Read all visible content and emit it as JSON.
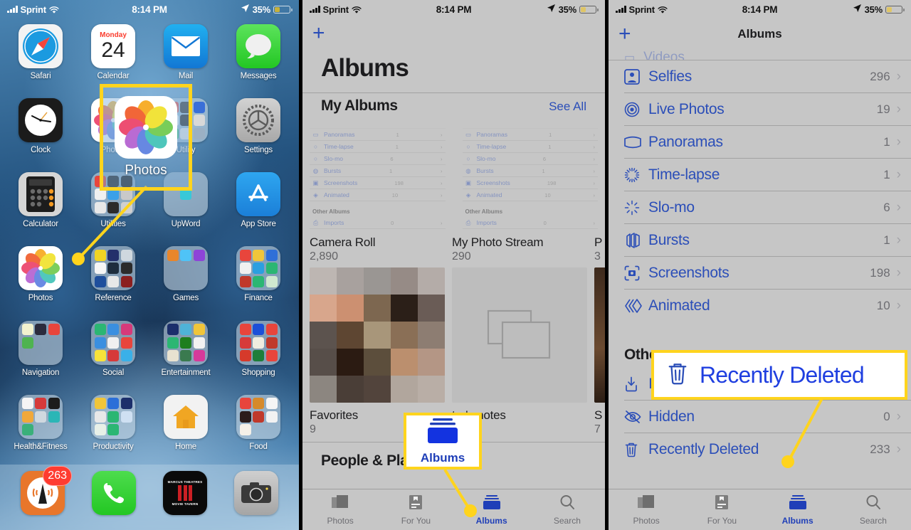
{
  "status_bar": {
    "carrier": "Sprint",
    "time": "8:14 PM",
    "battery": "35%"
  },
  "left_panel": {
    "apps": [
      {
        "label": "Safari",
        "icon": "safari-icon"
      },
      {
        "label": "Calendar",
        "icon": "calendar-icon",
        "weekday": "Monday",
        "day": "24"
      },
      {
        "label": "Mail",
        "icon": "mail-icon"
      },
      {
        "label": "Messages",
        "icon": "messages-icon"
      },
      {
        "label": "Clock",
        "icon": "clock-icon"
      },
      {
        "label": "Photos",
        "icon": "photos-icon"
      },
      {
        "label": "Utility",
        "icon": "utility-folder-icon"
      },
      {
        "label": "Settings",
        "icon": "settings-gear-icon"
      },
      {
        "label": "Calculator",
        "icon": "calculator-icon"
      },
      {
        "label": "Utilities",
        "icon": "utilities-folder-icon"
      },
      {
        "label": "UpWord",
        "icon": "upword-folder-icon"
      },
      {
        "label": "App Store",
        "icon": "app-store-icon"
      },
      {
        "label": "Photos",
        "icon": "photos-icon"
      },
      {
        "label": "Reference",
        "icon": "reference-folder-icon"
      },
      {
        "label": "Games",
        "icon": "games-folder-icon"
      },
      {
        "label": "Finance",
        "icon": "finance-folder-icon"
      },
      {
        "label": "Navigation",
        "icon": "navigation-folder-icon"
      },
      {
        "label": "Social",
        "icon": "social-folder-icon"
      },
      {
        "label": "Entertainment",
        "icon": "entertainment-folder-icon"
      },
      {
        "label": "Shopping",
        "icon": "shopping-folder-icon"
      },
      {
        "label": "Health&Fitness",
        "icon": "health-fitness-folder-icon"
      },
      {
        "label": "Productivity",
        "icon": "productivity-folder-icon"
      },
      {
        "label": "Home",
        "icon": "home-app-icon"
      },
      {
        "label": "Food",
        "icon": "food-folder-icon"
      }
    ],
    "dock": [
      {
        "label": "Podcasts",
        "icon": "podcasts-icon",
        "badge": "263"
      },
      {
        "label": "Phone",
        "icon": "phone-icon",
        "badge": ""
      },
      {
        "label": "Marcus Theatres",
        "icon": "marcus-theatres-icon",
        "badge": "",
        "line1": "MARCUS THEATRES",
        "line2": "MOVIE TAVERN"
      },
      {
        "label": "Camera",
        "icon": "camera-icon",
        "badge": ""
      }
    ],
    "callout_label": "Photos"
  },
  "mid_panel": {
    "add_button": "+",
    "title": "Albums",
    "my_albums_header": "My Albums",
    "see_all": "See All",
    "ghost_list": {
      "items": [
        {
          "label": "Panoramas",
          "count": "1",
          "icon": "panorama-icon"
        },
        {
          "label": "Time-lapse",
          "count": "1",
          "icon": "timelapse-icon"
        },
        {
          "label": "Slo-mo",
          "count": "6",
          "icon": "slomo-icon"
        },
        {
          "label": "Bursts",
          "count": "1",
          "icon": "bursts-icon"
        },
        {
          "label": "Screenshots",
          "count": "198",
          "icon": "screenshots-icon"
        },
        {
          "label": "Animated",
          "count": "10",
          "icon": "animated-icon"
        }
      ],
      "other_header": "Other Albums",
      "other_items": [
        {
          "label": "Imports",
          "count": "0",
          "icon": "imports-icon"
        }
      ]
    },
    "albums": [
      {
        "title": "Camera Roll",
        "count": "2,890",
        "thumb": "mosaic"
      },
      {
        "title": "My Photo Stream",
        "count": "290",
        "thumb": "empty"
      },
      {
        "title": "P",
        "count": "3",
        "thumb": "dark"
      }
    ],
    "albums_row2": [
      {
        "title": "Favorites",
        "count": "9"
      },
      {
        "title": "tor's notes",
        "count": ""
      },
      {
        "title": "S",
        "count": "7"
      }
    ],
    "people_places": "People & Places",
    "tabs": [
      {
        "label": "Photos",
        "icon": "photos-tab-icon",
        "active": false
      },
      {
        "label": "For You",
        "icon": "for-you-tab-icon",
        "active": false
      },
      {
        "label": "Albums",
        "icon": "albums-tab-icon",
        "active": true
      },
      {
        "label": "Search",
        "icon": "search-tab-icon",
        "active": false
      }
    ],
    "callout_label": "Albums"
  },
  "right_panel": {
    "add_button": "+",
    "title": "Albums",
    "items": [
      {
        "label": "Selfies",
        "count": "296",
        "icon": "selfies-icon"
      },
      {
        "label": "Live Photos",
        "count": "19",
        "icon": "live-photos-icon"
      },
      {
        "label": "Panoramas",
        "count": "1",
        "icon": "panorama-icon"
      },
      {
        "label": "Time-lapse",
        "count": "1",
        "icon": "timelapse-icon"
      },
      {
        "label": "Slo-mo",
        "count": "6",
        "icon": "slomo-icon"
      },
      {
        "label": "Bursts",
        "count": "1",
        "icon": "bursts-icon"
      },
      {
        "label": "Screenshots",
        "count": "198",
        "icon": "screenshots-icon"
      },
      {
        "label": "Animated",
        "count": "10",
        "icon": "animated-icon"
      }
    ],
    "other_header": "Other",
    "other_items": [
      {
        "label": "Imports",
        "count": "",
        "icon": "imports-icon"
      },
      {
        "label": "Hidden",
        "count": "0",
        "icon": "hidden-eye-icon"
      },
      {
        "label": "Recently Deleted",
        "count": "233",
        "icon": "trash-icon"
      }
    ],
    "tabs": [
      {
        "label": "Photos",
        "icon": "photos-tab-icon",
        "active": false
      },
      {
        "label": "For You",
        "icon": "for-you-tab-icon",
        "active": false
      },
      {
        "label": "Albums",
        "icon": "albums-tab-icon",
        "active": true
      },
      {
        "label": "Search",
        "icon": "search-tab-icon",
        "active": false
      }
    ],
    "callout_label": "Recently Deleted"
  },
  "colors": {
    "highlight": "#ffd41d",
    "ios_blue": "#2b4eb8",
    "tab_active": "#1f3fb8",
    "panel_bg": "#c6c6c6"
  }
}
